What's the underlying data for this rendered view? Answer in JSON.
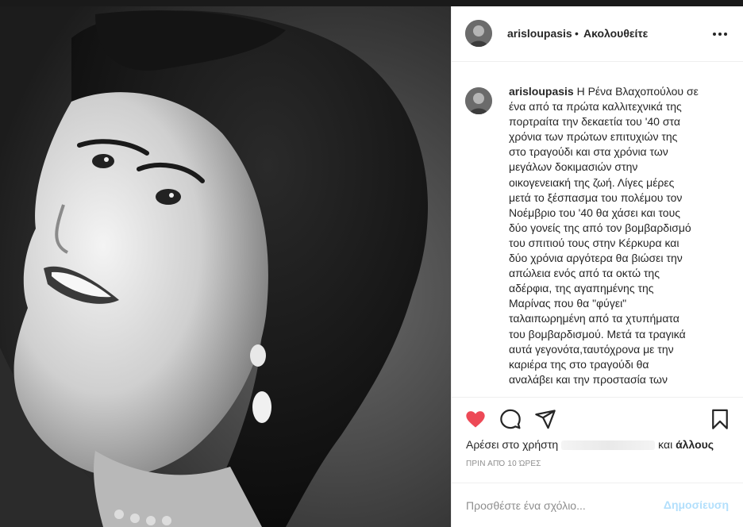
{
  "post": {
    "username": "arisloupasis",
    "separator": "•",
    "follow_label": "Ακολουθείτε",
    "caption_lines": [
      "Η Ρένα Βλαχοπούλου σε",
      "ένα από τα πρώτα καλλιτεχνικά της",
      "πορτραίτα την δεκαετία του '40 στα",
      "χρόνια των πρώτων επιτυχιών της",
      "στο τραγούδι και στα χρόνια των",
      "μεγάλων δοκιμασιών στην",
      "οικογενειακή της ζωή. Λίγες μέρες",
      "μετά το ξέσπασμα του πολέμου τον",
      "Νοέμβριο του '40 θα χάσει και τους",
      "δύο γονείς της από τον βομβαρδισμό",
      "του σπιτιού τους στην Κέρκυρα και",
      "δύο χρόνια αργότερα θα βιώσει την",
      "απώλεια ενός από τα οκτώ της",
      "αδέρφια, της αγαπημένης της",
      "Μαρίνας που θα \"φύγει\"",
      "ταλαιπωρημένη από τα χτυπήματα",
      "του βομβαρδισμού. Μετά τα τραγικά",
      "αυτά γεγονότα,ταυτόχρονα με την",
      "καριέρα της στο τραγούδι θα",
      "αναλάβει και την προστασία των"
    ],
    "likes_prefix": "Αρέσει στο χρήστη",
    "likes_and": "και",
    "likes_others": "άλλους",
    "timestamp": "ΠΡΙΝ ΑΠΌ 10 ΏΡΕΣ",
    "comment_placeholder": "Προσθέστε ένα σχόλιο...",
    "post_button_label": "Δημοσίευση"
  },
  "icons": {
    "like": "heart-icon",
    "comment": "comment-icon",
    "share": "share-icon",
    "save": "bookmark-icon",
    "more": "more-icon"
  },
  "colors": {
    "like": "#ed4956",
    "post_disabled": "#b2dffc",
    "text": "#262626",
    "muted": "#8e8e8e",
    "border": "#efefef"
  }
}
